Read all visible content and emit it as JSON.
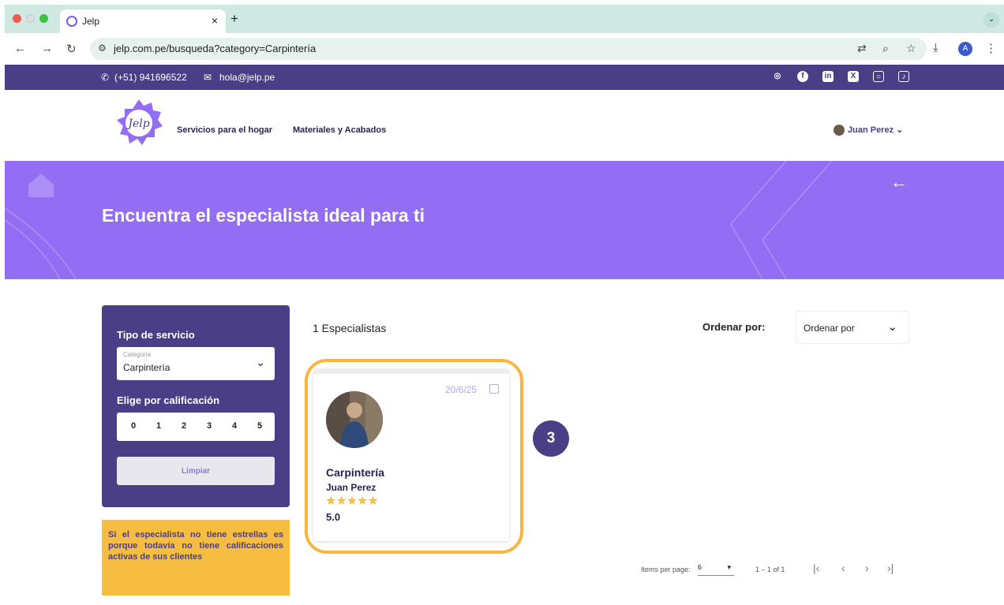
{
  "browser": {
    "tab_title": "Jelp",
    "tab_close": "×",
    "new_tab": "+",
    "menu_chevron": "⌄",
    "url": "jelp.com.pe/busqueda?category=Carpintería",
    "profile_initial": "A"
  },
  "topbar": {
    "phone": "(+51) 941696522",
    "email": "hola@jelp.pe",
    "socials": [
      "whatsapp-icon",
      "facebook-icon",
      "linkedin-icon",
      "x-icon",
      "instagram-icon",
      "tiktok-icon"
    ]
  },
  "header": {
    "logo_text": "Jelp",
    "nav": [
      "Servicios para el hogar",
      "Materiales y Acabados"
    ],
    "user_name": "Juan Perez"
  },
  "hero": {
    "title": "Encuentra el especialista ideal para ti"
  },
  "filters": {
    "service_heading": "Tipo de servicio",
    "category_label": "Categoría",
    "category_value": "Carpintería",
    "rating_heading": "Elige por calificación",
    "ratings": [
      "0",
      "1",
      "2",
      "3",
      "4",
      "5"
    ],
    "clear_label": "Limpiar"
  },
  "notice": {
    "text": "Si el especialista no tiene estrellas es porque todavía no tiene calificaciones activas de sus clientes"
  },
  "results": {
    "count_label": "1 Especialistas",
    "sort_label": "Ordenar por:",
    "sort_value": "Ordenar por"
  },
  "card": {
    "date": "20/6/25",
    "category": "Carpintería",
    "name": "Juan Perez",
    "stars": "★★★★★",
    "rating": 5,
    "score": "5.0"
  },
  "step_badge": "3",
  "pagination": {
    "items_label": "Items per page:",
    "items_value": "6",
    "range": "1 – 1 of 1"
  },
  "colors": {
    "brand_dark": "#4a3e86",
    "brand_light": "#936ef4",
    "accent": "#f6bd41"
  }
}
